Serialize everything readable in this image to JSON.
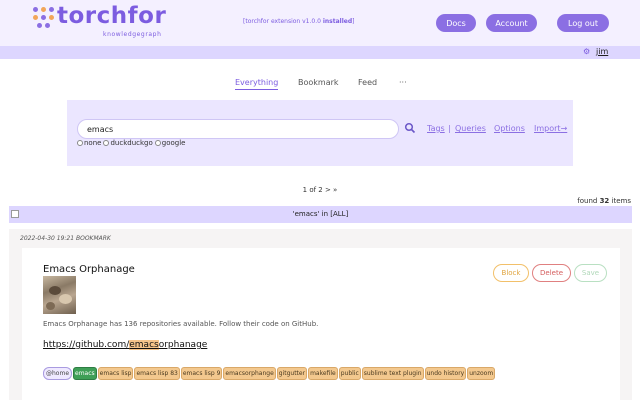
{
  "header": {
    "logo_text": "torchfor",
    "logo_sub": "knowledgegraph",
    "ext_prefix": "[torchfor extension v1.0.0 ",
    "ext_status": "installed",
    "ext_suffix": "]",
    "buttons": {
      "docs": "Docs",
      "account": "Account",
      "logout": "Log out"
    },
    "user": "jim",
    "gear_icon": "gear-icon"
  },
  "tabs": [
    "Everything",
    "Bookmark",
    "Feed",
    "···"
  ],
  "active_tab": "Everything",
  "search": {
    "value": "emacs",
    "placeholder": "",
    "engines": [
      "none",
      "duckduckgo",
      "google"
    ],
    "links": {
      "tags": "Tags",
      "sep": "|",
      "queries": "Queries",
      "options": "Options",
      "import": "Import"
    }
  },
  "pagination": "1 of 2 > »",
  "found": {
    "prefix": "found ",
    "count": "32",
    "suffix": " items"
  },
  "results_title": "'emacs' in [ALL]",
  "result": {
    "meta": "2022-04-30 19:21 BOOKMARK",
    "title": "Emacs Orphanage",
    "description": "Emacs Orphanage has 136 repositories available. Follow their code on GitHub.",
    "url_pre": "https://github.com/",
    "url_hl": "emacs",
    "url_post": "orphanage",
    "actions": {
      "block": "Block",
      "delete": "Delete",
      "save": "Save"
    },
    "tags": [
      "@home",
      "emacs",
      "emacs lisp",
      "emacs lisp 83",
      "emacs lisp 9",
      "emacsorphange",
      "gitgutter",
      "makefile",
      "public",
      "sublime text plugin",
      "undo history",
      "unzoom"
    ]
  },
  "colors": {
    "brand": "#8b6fe3",
    "header_bg": "#f4f0ff",
    "strip": "#ddd6ff",
    "tag": "#f3c88e",
    "tag_green": "#3f9f57"
  }
}
